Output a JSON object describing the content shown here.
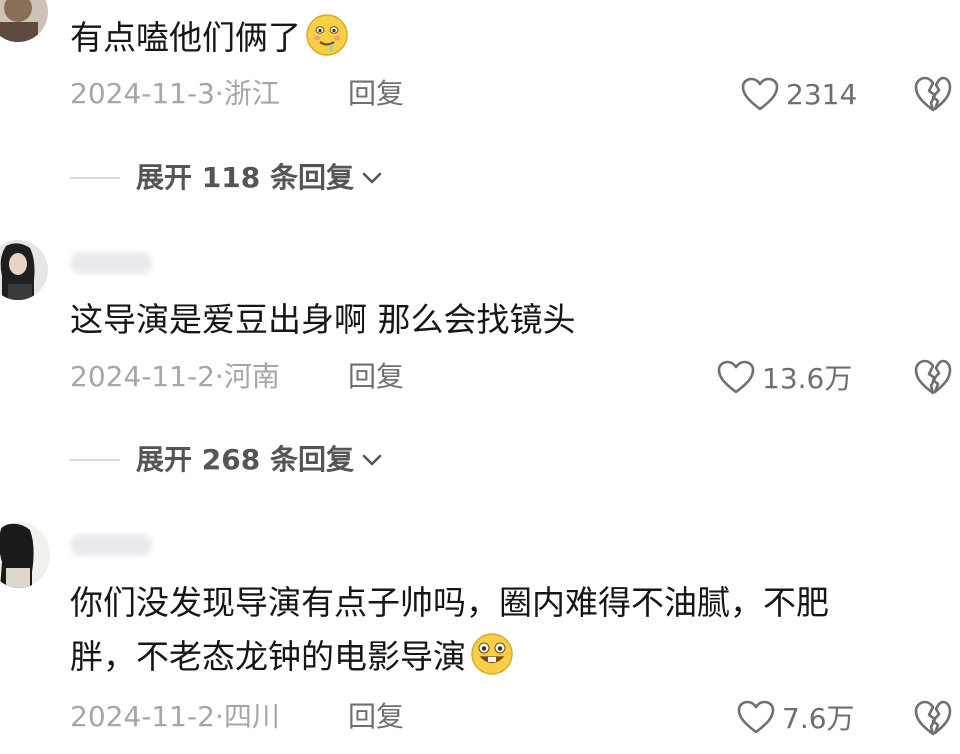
{
  "comments": [
    {
      "text": "有点嗑他们俩了",
      "emoji_icon": "drooling-face-emoji",
      "date": "2024-11-3·",
      "location": "浙江",
      "reply_label": "回复",
      "likes": "2314",
      "expand_label": "展开 118 条回复"
    },
    {
      "text": "这导演是爱豆出身啊  那么会找镜头",
      "date": "2024-11-2·",
      "location": "河南",
      "reply_label": "回复",
      "likes": "13.6万",
      "expand_label": "展开 268 条回复"
    },
    {
      "text_line1": "你们没发现导演有点子帅吗，圈内难得不油腻，不肥",
      "text_line2": "胖，不老态龙钟的电影导演",
      "emoji_icon": "grinning-buck-teeth-emoji",
      "date": "2024-11-2·",
      "location": "四川",
      "reply_label": "回复",
      "likes": "7.6万"
    }
  ],
  "colors": {
    "text": "#161616",
    "meta": "#a6a6a6",
    "action": "#6f6f6f",
    "background": "#ffffff"
  }
}
